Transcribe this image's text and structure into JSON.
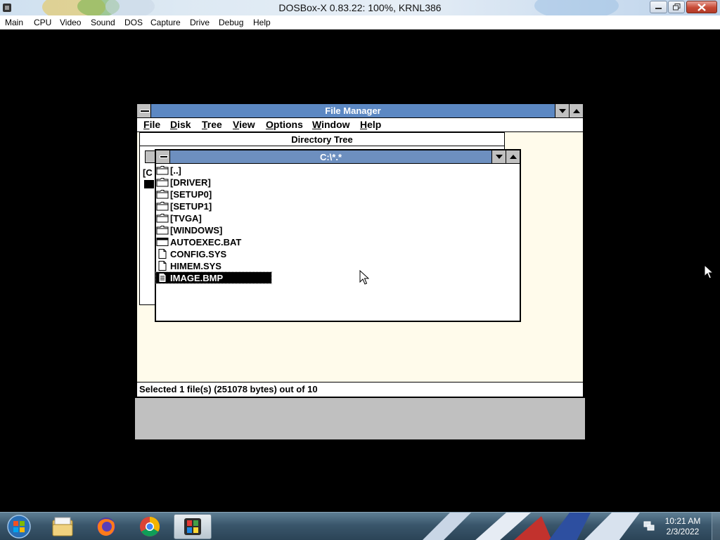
{
  "host_window": {
    "title": "DOSBox-X 0.83.22: 100%, KRNL386",
    "app_icon": "dosbox-icon",
    "controls": [
      "minimize-icon",
      "restore-icon",
      "close-icon"
    ]
  },
  "host_menu": {
    "items": [
      "Main",
      "CPU",
      "Video",
      "Sound",
      "DOS",
      "Capture",
      "Drive",
      "Debug",
      "Help"
    ]
  },
  "file_manager": {
    "title": "File Manager",
    "menu": [
      {
        "label": "File",
        "hotkey": "F",
        "rest": "ile"
      },
      {
        "label": "Disk",
        "hotkey": "D",
        "rest": "isk"
      },
      {
        "label": "Tree",
        "hotkey": "T",
        "rest": "ree"
      },
      {
        "label": "View",
        "hotkey": "V",
        "rest": "iew"
      },
      {
        "label": "Options",
        "hotkey": "O",
        "rest": "ptions"
      },
      {
        "label": "Window",
        "hotkey": "W",
        "rest": "indow"
      },
      {
        "label": "Help",
        "hotkey": "H",
        "rest": "elp"
      }
    ],
    "tree_window": {
      "title": "Directory Tree",
      "drive_label": "[C"
    },
    "dir_window": {
      "title": "C:\\*.*",
      "files": [
        {
          "name": "[..]",
          "type": "folder"
        },
        {
          "name": "[DRIVER]",
          "type": "folder"
        },
        {
          "name": "[SETUP0]",
          "type": "folder"
        },
        {
          "name": "[SETUP1]",
          "type": "folder"
        },
        {
          "name": "[TVGA]",
          "type": "folder"
        },
        {
          "name": "[WINDOWS]",
          "type": "folder"
        },
        {
          "name": "AUTOEXEC.BAT",
          "type": "program"
        },
        {
          "name": "CONFIG.SYS",
          "type": "file"
        },
        {
          "name": "HIMEM.SYS",
          "type": "file"
        },
        {
          "name": "IMAGE.BMP",
          "type": "document",
          "selected": true
        }
      ]
    },
    "status": "Selected 1 file(s) (251078 bytes) out of 10"
  },
  "taskbar": {
    "pinned": [
      "windows-start-icon",
      "file-explorer-icon",
      "firefox-icon",
      "chrome-icon",
      "dosbox-icon"
    ],
    "active": "dosbox-icon",
    "clock_time": "10:21 AM",
    "clock_date": "2/3/2022"
  },
  "colors": {
    "fm_titlebar": "#5c88c3",
    "workspace": "#fffbeb",
    "selection": "#000000"
  }
}
